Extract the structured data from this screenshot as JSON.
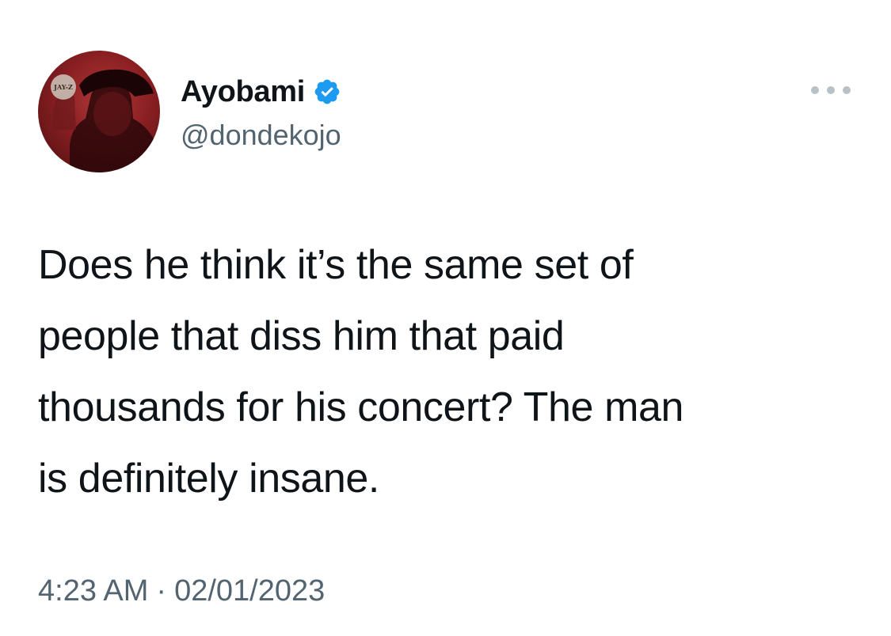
{
  "author": {
    "display_name": "Ayobami",
    "handle": "@dondekojo",
    "verified": true,
    "avatar_caption": "JAY-Z"
  },
  "tweet": {
    "text": "Does he think it’s the same set of\npeople that diss him that paid\nthousands for his concert? The man\nis definitely insane.",
    "time": "4:23 AM",
    "separator": "·",
    "date": "02/01/2023"
  },
  "icons": {
    "verified": "verified-badge-icon",
    "more": "more-options-icon"
  },
  "colors": {
    "text": "#0f1419",
    "secondary": "#536471",
    "verified_blue": "#1d9bf0",
    "avatar_red": "#8a1f22"
  }
}
